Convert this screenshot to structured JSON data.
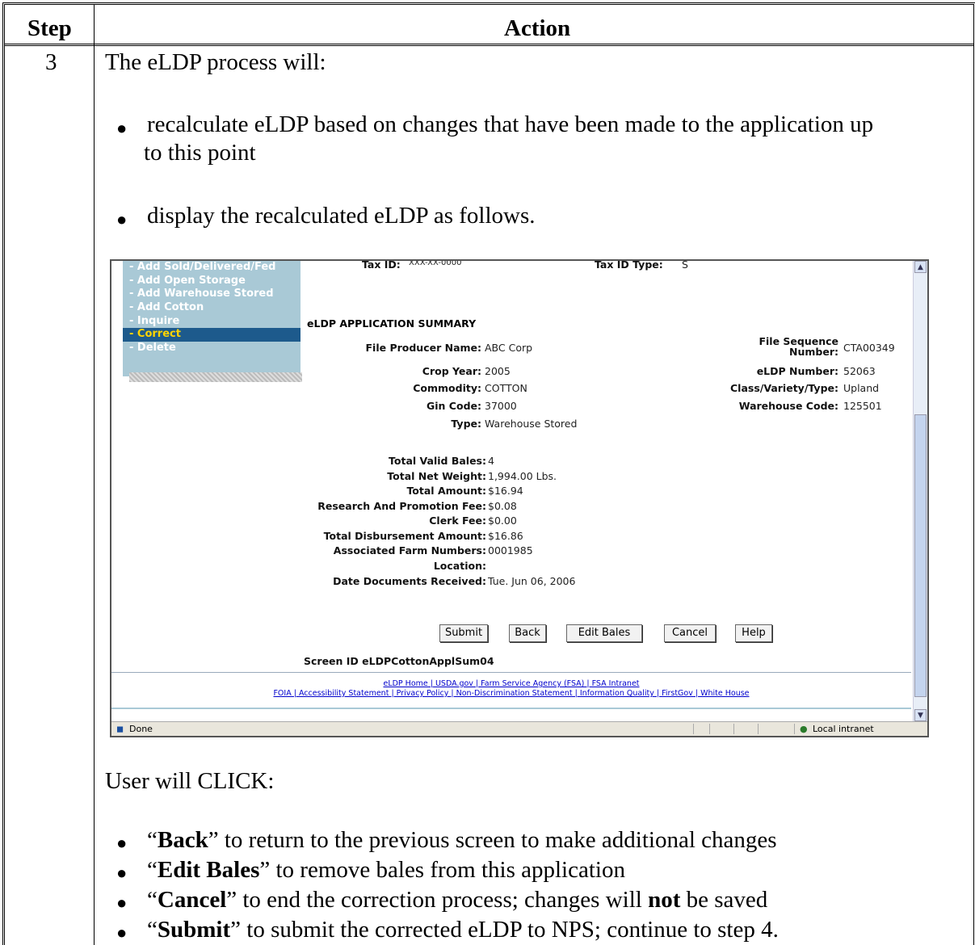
{
  "table": {
    "header_step": "Step",
    "header_action": "Action",
    "step_number": "3"
  },
  "content": {
    "intro": "The eLDP process will:",
    "bullets": [
      "recalculate eLDP based on changes that have been made to the application up",
      "to this point",
      "display the recalculated eLDP as follows."
    ],
    "user_click": "User will CLICK:",
    "click_items": [
      {
        "quote_open": "“",
        "bold": "Back",
        "rest": "” to return to the previous screen to make additional changes"
      },
      {
        "quote_open": "“",
        "bold": "Edit Bales",
        "rest": "” to remove bales from this application"
      },
      {
        "quote_open": "“",
        "bold": "Cancel",
        "rest_a": "” to end the correction process; changes will ",
        "bold2": "not",
        "rest_b": " be saved"
      },
      {
        "quote_open": "“",
        "bold": "Submit",
        "rest": "” to submit the corrected eLDP to NPS; continue to step 4."
      }
    ]
  },
  "screenshot": {
    "top_fields": {
      "tax_id_label": "Tax ID:",
      "tax_id_value": "XXX-XX-0000",
      "tax_type_label": "Tax ID Type:",
      "tax_type_value": "S"
    },
    "menu": [
      "- Add Sold/Delivered/Fed",
      "- Add Open Storage",
      "- Add Warehouse Stored",
      "- Add Cotton",
      "- Inquire",
      "- Correct",
      "- Delete"
    ],
    "section_title": "eLDP APPLICATION SUMMARY",
    "left_fields": [
      {
        "label": "File Producer Name:",
        "value": "ABC Corp"
      },
      {
        "label": "Crop Year:",
        "value": "2005"
      },
      {
        "label": "Commodity:",
        "value": "COTTON"
      },
      {
        "label": "Gin Code:",
        "value": "37000"
      },
      {
        "label": "Type:",
        "value": "Warehouse Stored"
      }
    ],
    "right_fields": [
      {
        "label": "File Sequence",
        "label2": "Number:",
        "value": "CTA00349"
      },
      {
        "label": "eLDP Number:",
        "value": "52063"
      },
      {
        "label": "Class/Variety/Type:",
        "value": "Upland"
      },
      {
        "label": "Warehouse Code:",
        "value": "125501"
      }
    ],
    "totals": [
      {
        "label": "Total Valid Bales:",
        "value": "4"
      },
      {
        "label": "Total Net Weight:",
        "value": "1,994.00  Lbs."
      },
      {
        "label": "Total Amount:",
        "value": "$16.94"
      },
      {
        "label": "Research And Promotion Fee:",
        "value": "$0.08"
      },
      {
        "label": "Clerk Fee:",
        "value": "$0.00"
      },
      {
        "label": "Total Disbursement Amount:",
        "value": "$16.86"
      },
      {
        "label": "Associated Farm Numbers:",
        "value": "0001985"
      },
      {
        "label": "Location:",
        "value": ""
      },
      {
        "label": "Date Documents Received:",
        "value": "Tue. Jun 06, 2006"
      }
    ],
    "buttons": {
      "submit": "Submit",
      "back": "Back",
      "edit_bales": "Edit Bales",
      "cancel": "Cancel",
      "help": "Help"
    },
    "screen_id": "Screen ID eLDPCottonApplSum04",
    "footer_line1": "eLDP Home | USDA.gov | Farm Service Agency (FSA) | FSA Intranet",
    "footer_line2": "FOIA | Accessibility Statement | Privacy Policy | Non-Discrimination Statement | Information Quality | FirstGov | White House",
    "status_left": "Done",
    "status_right": "Local intranet"
  }
}
